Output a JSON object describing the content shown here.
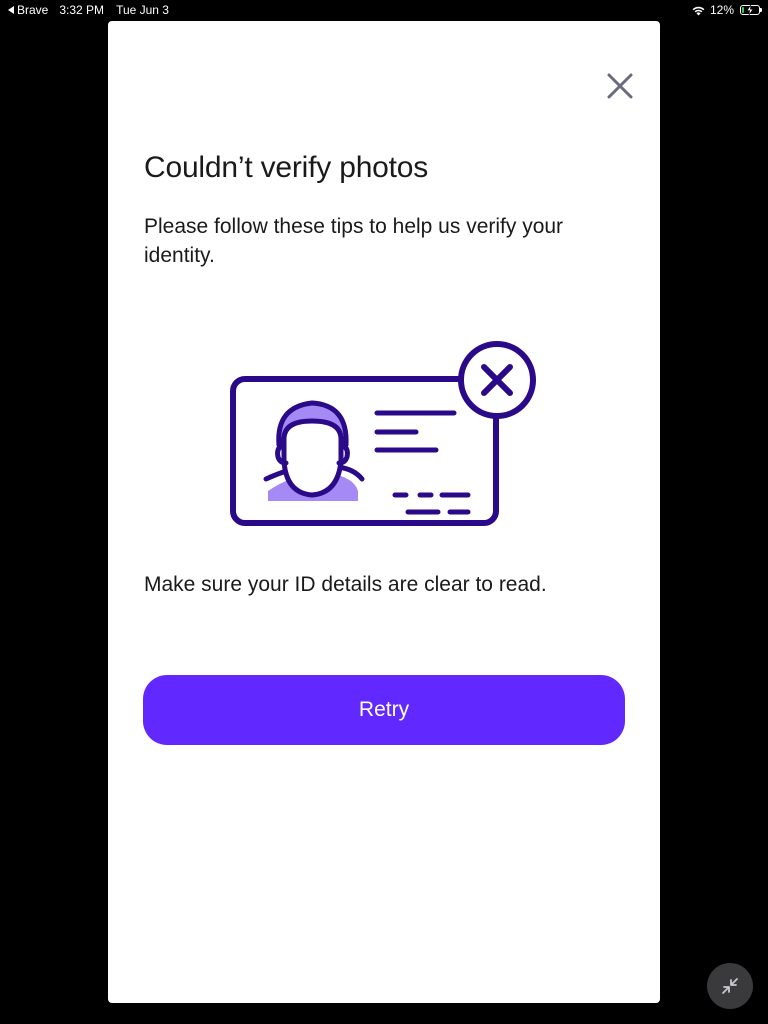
{
  "status_bar": {
    "back_app": "Brave",
    "time": "3:32 PM",
    "date": "Tue Jun 3",
    "battery_percent": "12%",
    "battery_level": 0.12
  },
  "modal": {
    "close_icon": "close-icon",
    "title": "Couldn’t verify photos",
    "subtitle": "Please follow these tips to help us verify your identity.",
    "illustration_icon": "id-card-error-illustration",
    "tip": "Make sure your ID details are clear to read.",
    "retry_label": "Retry"
  },
  "floating_button": {
    "icon": "collapse-arrows-icon"
  },
  "colors": {
    "accent": "#6128ff",
    "illustration_stroke": "#2b0a8a",
    "illustration_fill": "#a58af5",
    "close_icon": "#6b6b80"
  }
}
